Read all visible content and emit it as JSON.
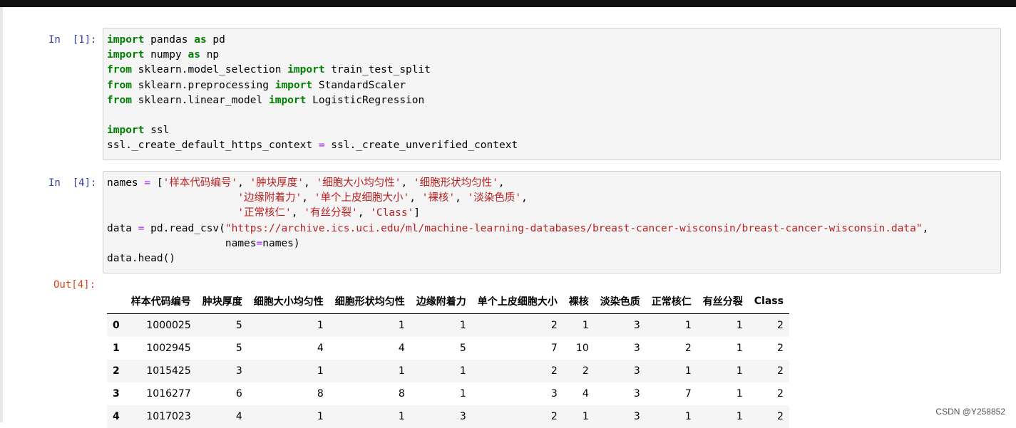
{
  "cells": [
    {
      "prompt": "In  [1]:",
      "lines": [
        [
          [
            "kw",
            "import"
          ],
          [
            "sp",
            " pandas "
          ],
          [
            "kw",
            "as"
          ],
          [
            "sp",
            " pd"
          ]
        ],
        [
          [
            "kw",
            "import"
          ],
          [
            "sp",
            " numpy "
          ],
          [
            "kw",
            "as"
          ],
          [
            "sp",
            " np"
          ]
        ],
        [
          [
            "kw",
            "from"
          ],
          [
            "sp",
            " sklearn.model_selection "
          ],
          [
            "kw",
            "import"
          ],
          [
            "sp",
            " train_test_split"
          ]
        ],
        [
          [
            "kw",
            "from"
          ],
          [
            "sp",
            " sklearn.preprocessing "
          ],
          [
            "kw",
            "import"
          ],
          [
            "sp",
            " StandardScaler"
          ]
        ],
        [
          [
            "kw",
            "from"
          ],
          [
            "sp",
            " sklearn.linear_model "
          ],
          [
            "kw",
            "import"
          ],
          [
            "sp",
            " LogisticRegression"
          ]
        ],
        [
          [
            "sp",
            ""
          ]
        ],
        [
          [
            "kw",
            "import"
          ],
          [
            "sp",
            " ssl"
          ]
        ],
        [
          [
            "sp",
            "ssl._create_default_https_context "
          ],
          [
            "op",
            "="
          ],
          [
            "sp",
            " ssl._create_unverified_context"
          ]
        ]
      ]
    },
    {
      "prompt": "In  [4]:",
      "lines": [
        [
          [
            "sp",
            "names "
          ],
          [
            "op",
            "="
          ],
          [
            "sp",
            " ["
          ],
          [
            "str",
            "'样本代码编号'"
          ],
          [
            "sp",
            ", "
          ],
          [
            "str",
            "'肿块厚度'"
          ],
          [
            "sp",
            ", "
          ],
          [
            "str",
            "'细胞大小均匀性'"
          ],
          [
            "sp",
            ", "
          ],
          [
            "str",
            "'细胞形状均匀性'"
          ],
          [
            "sp",
            ","
          ]
        ],
        [
          [
            "sp",
            "                     "
          ],
          [
            "str",
            "'边缘附着力'"
          ],
          [
            "sp",
            ", "
          ],
          [
            "str",
            "'单个上皮细胞大小'"
          ],
          [
            "sp",
            ", "
          ],
          [
            "str",
            "'裸核'"
          ],
          [
            "sp",
            ", "
          ],
          [
            "str",
            "'淡染色质'"
          ],
          [
            "sp",
            ","
          ]
        ],
        [
          [
            "sp",
            "                     "
          ],
          [
            "str",
            "'正常核仁'"
          ],
          [
            "sp",
            ", "
          ],
          [
            "str",
            "'有丝分裂'"
          ],
          [
            "sp",
            ", "
          ],
          [
            "str",
            "'Class'"
          ],
          [
            "sp",
            "]"
          ]
        ],
        [
          [
            "sp",
            "data "
          ],
          [
            "op",
            "="
          ],
          [
            "sp",
            " pd.read_csv("
          ],
          [
            "str",
            "\"https://archive.ics.uci.edu/ml/machine-learning-databases/breast-cancer-wisconsin/breast-cancer-wisconsin.data\""
          ],
          [
            "sp",
            ","
          ]
        ],
        [
          [
            "sp",
            "                   names"
          ],
          [
            "op",
            "="
          ],
          [
            "sp",
            "names)"
          ]
        ],
        [
          [
            "sp",
            "data.head()"
          ]
        ]
      ]
    }
  ],
  "output": {
    "prompt": "Out[4]:",
    "columns": [
      "",
      "样本代码编号",
      "肿块厚度",
      "细胞大小均匀性",
      "细胞形状均匀性",
      "边缘附着力",
      "单个上皮细胞大小",
      "裸核",
      "淡染色质",
      "正常核仁",
      "有丝分裂",
      "Class"
    ],
    "rows": [
      [
        "0",
        "1000025",
        "5",
        "1",
        "1",
        "1",
        "2",
        "1",
        "3",
        "1",
        "1",
        "2"
      ],
      [
        "1",
        "1002945",
        "5",
        "4",
        "4",
        "5",
        "7",
        "10",
        "3",
        "2",
        "1",
        "2"
      ],
      [
        "2",
        "1015425",
        "3",
        "1",
        "1",
        "1",
        "2",
        "2",
        "3",
        "1",
        "1",
        "2"
      ],
      [
        "3",
        "1016277",
        "6",
        "8",
        "8",
        "1",
        "3",
        "4",
        "3",
        "7",
        "1",
        "2"
      ],
      [
        "4",
        "1017023",
        "4",
        "1",
        "1",
        "3",
        "2",
        "1",
        "3",
        "1",
        "1",
        "2"
      ]
    ]
  },
  "watermark": "CSDN @Y258852"
}
